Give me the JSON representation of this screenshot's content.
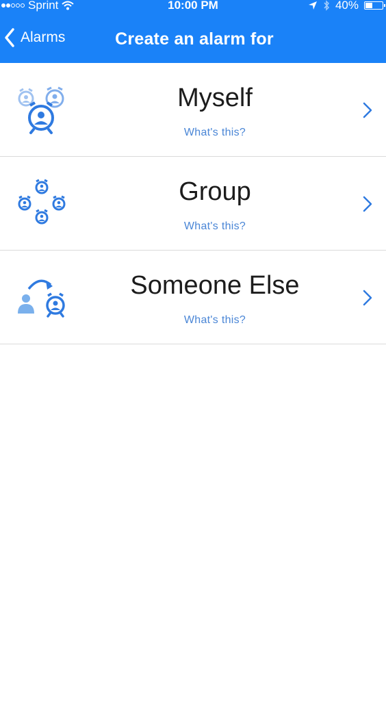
{
  "status_bar": {
    "carrier": "Sprint",
    "time": "10:00 PM",
    "battery": "40%"
  },
  "nav": {
    "back_label": "Alarms",
    "title": "Create an alarm for"
  },
  "options": [
    {
      "label": "Myself",
      "help": "What's this?",
      "icon": "alarm-myself-icon"
    },
    {
      "label": "Group",
      "help": "What's this?",
      "icon": "alarm-group-icon"
    },
    {
      "label": "Someone Else",
      "help": "What's this?",
      "icon": "alarm-someone-else-icon"
    }
  ],
  "colors": {
    "header": "#1a82f8",
    "accent": "#2f7ae0",
    "link": "#4a86d6"
  }
}
